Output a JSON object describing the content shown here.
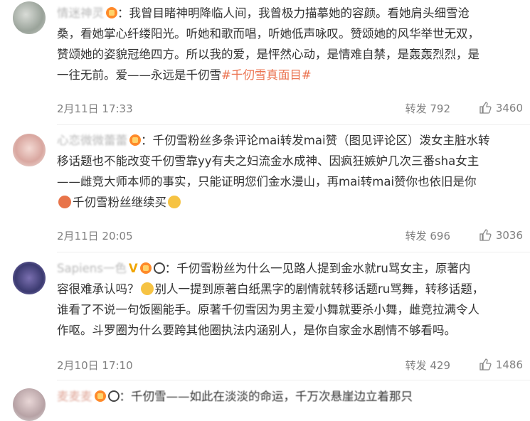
{
  "comments": [
    {
      "username": "情迷神灵",
      "text_lines": [
        "：我曾目睹神明降临人间，我曾极力描摹她的容颜。看她肩头细雪沧",
        "桑，看她掌心纤缕阳光。听她和歌而唱，听她低声咏叹。赞颂她的风华举世无双，",
        "赞颂她的姿貌冠绝四方。所以我的爱，是怦然心动，是情难自禁，是轰轰烈烈，是",
        "一往无前。爱——永远是千仞雪"
      ],
      "topic": "#千仞雪真面目#",
      "date": "2月11日 17:33",
      "repost": "转发 792",
      "likes": "3460"
    },
    {
      "username": "心恋微微蕾蕾",
      "text_lines": [
        "：千仞雪粉丝多条评论mai转发mai赞（图见评论区）泼女主脏水转",
        "移话题也不能改变千仞雪靠yy有夫之妇流金水成神、因疯狂嫉妒几次三番sha女主",
        "——雌竞大师本师的事实，只能证明您们金水漫山，再mai转mai赞你也依旧是你",
        "千仞雪粉丝继续买"
      ],
      "date": "2月11日 20:05",
      "repost": "转发 696",
      "likes": "3036"
    },
    {
      "username": "Sapiens一色",
      "text_lines": [
        "：千仞雪粉丝为什么一见路人提到金水就ru骂女主，原著内",
        "容很难承认吗？",
        "别人一提到原著白纸黑字的剧情就转移话题ru骂舞，转移话题，",
        "谁看了不说一句饭圈能手。原著千仞雪因为男主爱小舞就要杀小舞，雌竞拉满令人",
        "作呕。斗罗圈为什么要跨其他圈执法内涵别人，是你自家金水剧情不够看吗。"
      ],
      "date": "2月10日 17:10",
      "repost": "转发 429",
      "likes": "1486"
    },
    {
      "username": "麦麦麦",
      "text_lines": [
        "：千仞雪——如此在淡淡的命运，千万次悬崖边立着那只"
      ]
    }
  ],
  "colors": {
    "topic": "#eb7350",
    "username": "#b9b9b9",
    "meta": "#808080"
  }
}
